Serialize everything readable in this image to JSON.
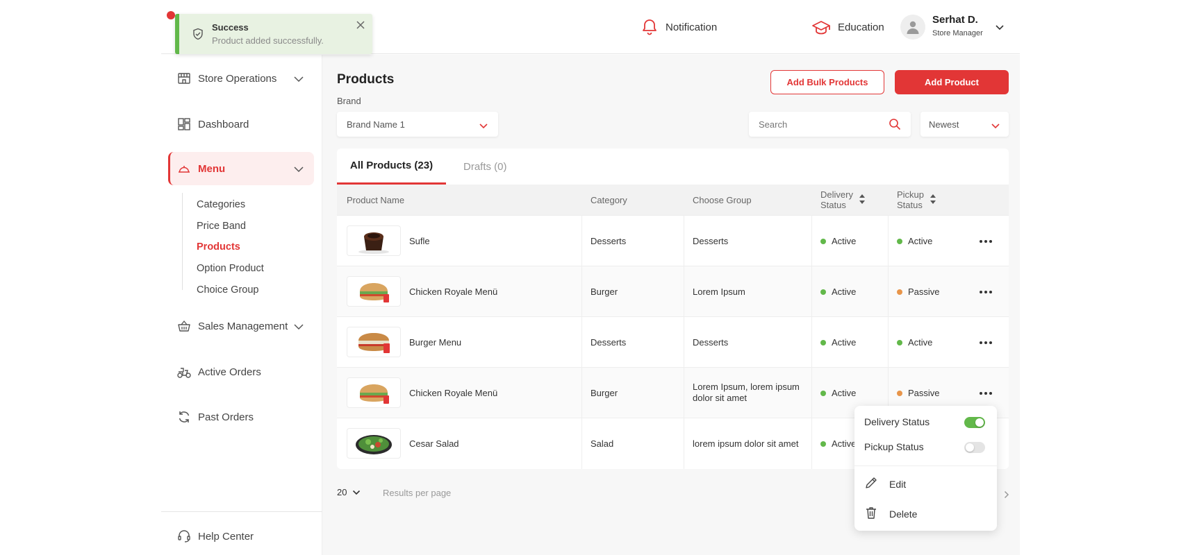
{
  "colors": {
    "accent": "#e23636",
    "success": "#62b84a",
    "warning": "#e8954a"
  },
  "toast": {
    "title": "Success",
    "message": "Product added successfully.",
    "icon": "shield-check-icon"
  },
  "header": {
    "notification_label": "Notification",
    "education_label": "Education",
    "user": {
      "name": "Serhat D.",
      "role": "Store Manager"
    }
  },
  "sidebar": {
    "items": [
      {
        "label": "Store Operations",
        "icon": "store-icon"
      },
      {
        "label": "Dashboard",
        "icon": "dashboard-icon"
      },
      {
        "label": "Menu",
        "icon": "cloche-icon"
      },
      {
        "label": "Sales Management",
        "icon": "basket-icon"
      },
      {
        "label": "Active Orders",
        "icon": "scooter-icon"
      },
      {
        "label": "Past Orders",
        "icon": "refresh-icon"
      }
    ],
    "menu_sub": [
      "Categories",
      "Price Band",
      "Products",
      "Option Product",
      "Choice Group"
    ],
    "help_label": "Help Center"
  },
  "main": {
    "title": "Products",
    "brand_label": "Brand",
    "brand_value": "Brand Name 1",
    "add_bulk_label": "Add Bulk Products",
    "add_product_label": "Add Product",
    "search_placeholder": "Search",
    "sort_value": "Newest",
    "tabs": [
      {
        "label": "All Products (23)"
      },
      {
        "label": "Drafts (0)"
      }
    ],
    "columns": {
      "name": "Product Name",
      "category": "Category",
      "group": "Choose Group",
      "delivery_1": "Delivery",
      "delivery_2": "Status",
      "pickup_1": "Pickup",
      "pickup_2": "Status"
    },
    "rows": [
      {
        "name": "Sufle",
        "category": "Desserts",
        "group": "Desserts",
        "delivery": "Active",
        "pickup": "Active",
        "image": "souffle"
      },
      {
        "name": "Chicken Royale Menü",
        "category": "Burger",
        "group": "Lorem Ipsum",
        "delivery": "Active",
        "pickup": "Passive",
        "image": "sandwich"
      },
      {
        "name": "Burger Menu",
        "category": "Desserts",
        "group": "Desserts",
        "delivery": "Active",
        "pickup": "Active",
        "image": "sandwich"
      },
      {
        "name": "Chicken Royale Menü",
        "category": "Burger",
        "group": "Lorem Ipsum, lorem ipsum dolor sit amet",
        "delivery": "Active",
        "pickup": "Passive",
        "image": "sandwich"
      },
      {
        "name": "Cesar Salad",
        "category": "Salad",
        "group": "lorem ipsum dolor sit amet",
        "delivery": "Active",
        "pickup": "",
        "image": "salad"
      }
    ],
    "per_page_value": "20",
    "per_page_label": "Results per page"
  },
  "context_menu": {
    "delivery_label": "Delivery Status",
    "delivery_on": true,
    "pickup_label": "Pickup Status",
    "pickup_on": false,
    "edit_label": "Edit",
    "delete_label": "Delete"
  }
}
